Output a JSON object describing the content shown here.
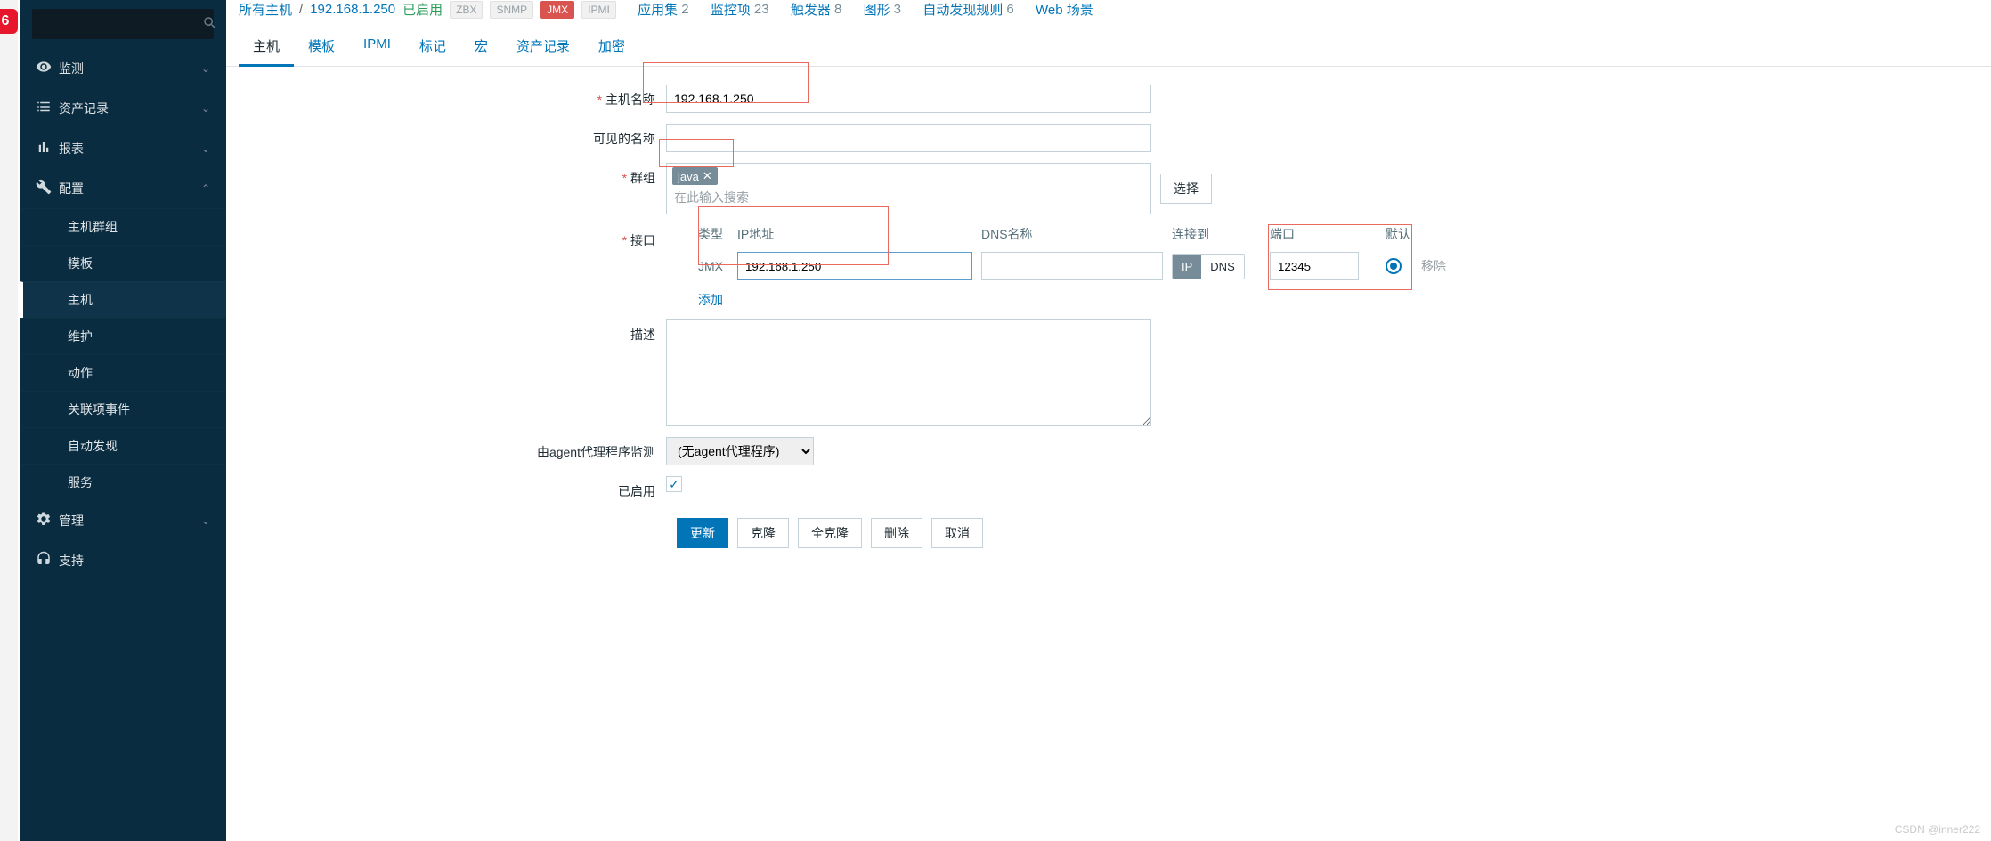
{
  "sidebar": {
    "search_placeholder": "",
    "items": [
      {
        "icon": "eye",
        "label": "监测"
      },
      {
        "icon": "list",
        "label": "资产记录"
      },
      {
        "icon": "bar",
        "label": "报表"
      },
      {
        "icon": "wrench",
        "label": "配置",
        "expanded": true,
        "children": [
          {
            "label": "主机群组"
          },
          {
            "label": "模板"
          },
          {
            "label": "主机",
            "active": true
          },
          {
            "label": "维护"
          },
          {
            "label": "动作"
          },
          {
            "label": "关联项事件"
          },
          {
            "label": "自动发现"
          },
          {
            "label": "服务"
          }
        ]
      },
      {
        "icon": "gear",
        "label": "管理"
      },
      {
        "icon": "headset",
        "label": "支持"
      }
    ]
  },
  "breadcrumb": {
    "all_hosts": "所有主机",
    "host_ip": "192.168.1.250",
    "enabled": "已启用",
    "badges": [
      "ZBX",
      "SNMP",
      "JMX",
      "IPMI"
    ],
    "stats": [
      {
        "label": "应用集",
        "count": 2
      },
      {
        "label": "监控项",
        "count": 23
      },
      {
        "label": "触发器",
        "count": 8
      },
      {
        "label": "图形",
        "count": 3
      },
      {
        "label": "自动发现规则",
        "count": 6
      },
      {
        "label": "Web 场景",
        "count": ""
      }
    ]
  },
  "tabs": [
    "主机",
    "模板",
    "IPMI",
    "标记",
    "宏",
    "资产记录",
    "加密"
  ],
  "form": {
    "host_name_label": "主机名称",
    "host_name_value": "192.168.1.250",
    "visible_name_label": "可见的名称",
    "visible_name_value": "",
    "groups_label": "群组",
    "group_tag": "java",
    "group_placeholder": "在此输入搜索",
    "select_btn": "选择",
    "interfaces_label": "接口",
    "iface_headers": {
      "type": "类型",
      "ip": "IP地址",
      "dns": "DNS名称",
      "conn": "连接到",
      "port": "端口",
      "def": "默认"
    },
    "iface_row": {
      "type": "JMX",
      "ip": "192.168.1.250",
      "dns": "",
      "conn_ip": "IP",
      "conn_dns": "DNS",
      "port": "12345",
      "remove": "移除"
    },
    "add_link": "添加",
    "desc_label": "描述",
    "desc_value": "",
    "proxy_label": "由agent代理程序监测",
    "proxy_value": "(无agent代理程序)",
    "enabled_label": "已启用",
    "enabled_checked": true
  },
  "actions": {
    "update": "更新",
    "clone": "克隆",
    "full_clone": "全克隆",
    "delete": "删除",
    "cancel": "取消"
  },
  "watermark": "CSDN @inner222"
}
